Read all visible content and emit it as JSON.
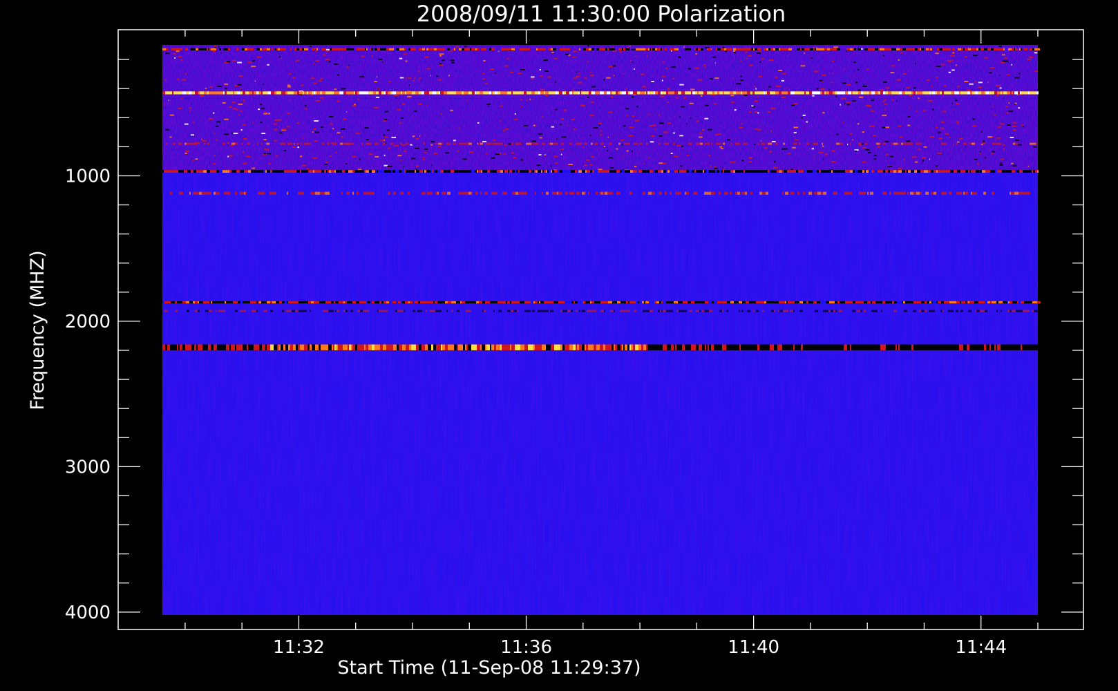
{
  "chart_data": {
    "type": "heatmap",
    "title": "2008/09/11 11:30:00 Polarization",
    "xlabel": "Start Time (11-Sep-08 11:29:37)",
    "ylabel": "Frequency (MHZ)",
    "x_ticks": [
      "11:32",
      "11:36",
      "11:40",
      "11:44"
    ],
    "y_ticks": [
      "1000",
      "2000",
      "3000",
      "4000"
    ],
    "x_tick_minutes": [
      32,
      36,
      40,
      44
    ],
    "y_tick_values": [
      1000,
      2000,
      3000,
      4000
    ],
    "xlim_minutes": [
      29.6,
      45.0
    ],
    "ylim_mhz": [
      100,
      4020
    ],
    "y_reversed": true,
    "colors": {
      "background": "#000000",
      "base": "#1a12f0",
      "base_dark": "#2a10c8",
      "red": "#d01818",
      "orange": "#ff7a18",
      "yellow": "#ffe040",
      "black": "#000000",
      "axis": "#ffffff"
    },
    "bands": [
      {
        "freq_mhz": 130,
        "width_mhz": 15,
        "style": "noisy"
      },
      {
        "freq_mhz": 430,
        "width_mhz": 20,
        "style": "yellow"
      },
      {
        "freq_mhz": 780,
        "width_mhz": 8,
        "style": "red-dashed"
      },
      {
        "freq_mhz": 970,
        "width_mhz": 18,
        "style": "black-red"
      },
      {
        "freq_mhz": 1120,
        "width_mhz": 20,
        "style": "red-dashed"
      },
      {
        "freq_mhz": 1870,
        "width_mhz": 15,
        "style": "black-red"
      },
      {
        "freq_mhz": 1930,
        "width_mhz": 10,
        "style": "black-red-light"
      },
      {
        "freq_mhz": 2180,
        "width_mhz": 40,
        "style": "orange-then-black"
      }
    ],
    "noisy_region_mhz": [
      100,
      960
    ]
  }
}
